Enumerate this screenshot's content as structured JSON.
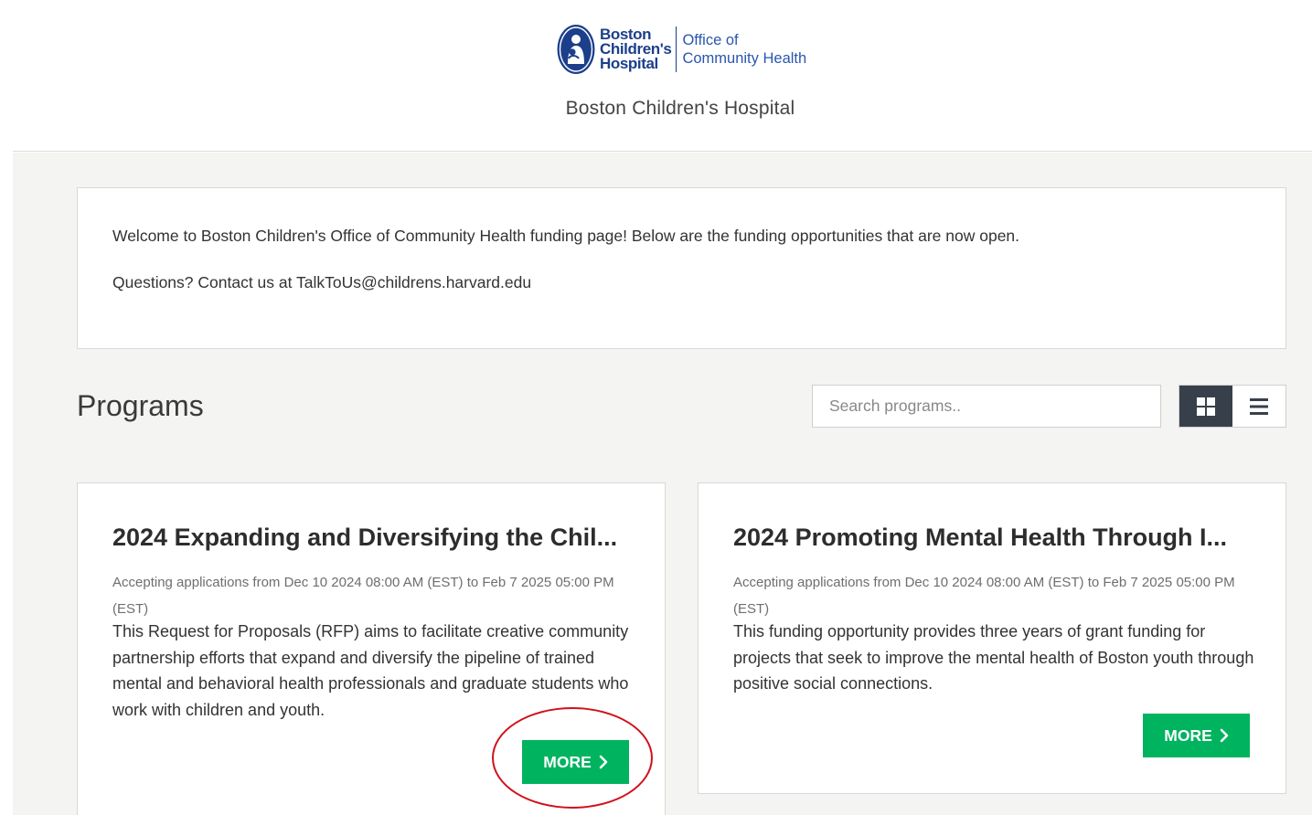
{
  "header": {
    "logo": {
      "name_line1": "Boston",
      "name_line2": "Children's",
      "name_line3": "Hospital",
      "dept_line1": "Office of",
      "dept_line2": "Community Health",
      "brand_color": "#1b3f8b"
    },
    "org_name": "Boston Children's Hospital"
  },
  "welcome": {
    "line1": "Welcome to Boston Children's Office of Community Health funding page! Below are the funding opportunities that are now open.",
    "line2": "Questions? Contact us at TalkToUs@childrens.harvard.edu"
  },
  "programs": {
    "title": "Programs",
    "search_placeholder": "Search programs..",
    "view_modes": [
      {
        "name": "grid",
        "icon": "grid-icon",
        "active": true
      },
      {
        "name": "list",
        "icon": "list-icon",
        "active": false
      }
    ],
    "cards": [
      {
        "title": "2024 Expanding and Diversifying the Chil...",
        "dates": "Accepting applications from Dec 10 2024 08:00 AM (EST) to Feb 7 2025 05:00 PM (EST)",
        "description": "This Request for Proposals (RFP) aims to facilitate creative community partnership efforts that expand and diversify the pipeline of trained mental and behavioral health professionals and graduate students who work with children and youth.",
        "button_label": "MORE"
      },
      {
        "title": "2024 Promoting Mental Health Through I...",
        "dates": "Accepting applications from Dec 10 2024 08:00 AM (EST) to Feb 7 2025 05:00 PM (EST)",
        "description": "This funding opportunity provides three years of grant funding for projects that seek to improve the mental health of Boston youth through positive social connections.",
        "button_label": "MORE"
      }
    ]
  },
  "colors": {
    "accent_green": "#00b35f",
    "toggle_active": "#37404a",
    "annotation_red": "#d0111b"
  }
}
